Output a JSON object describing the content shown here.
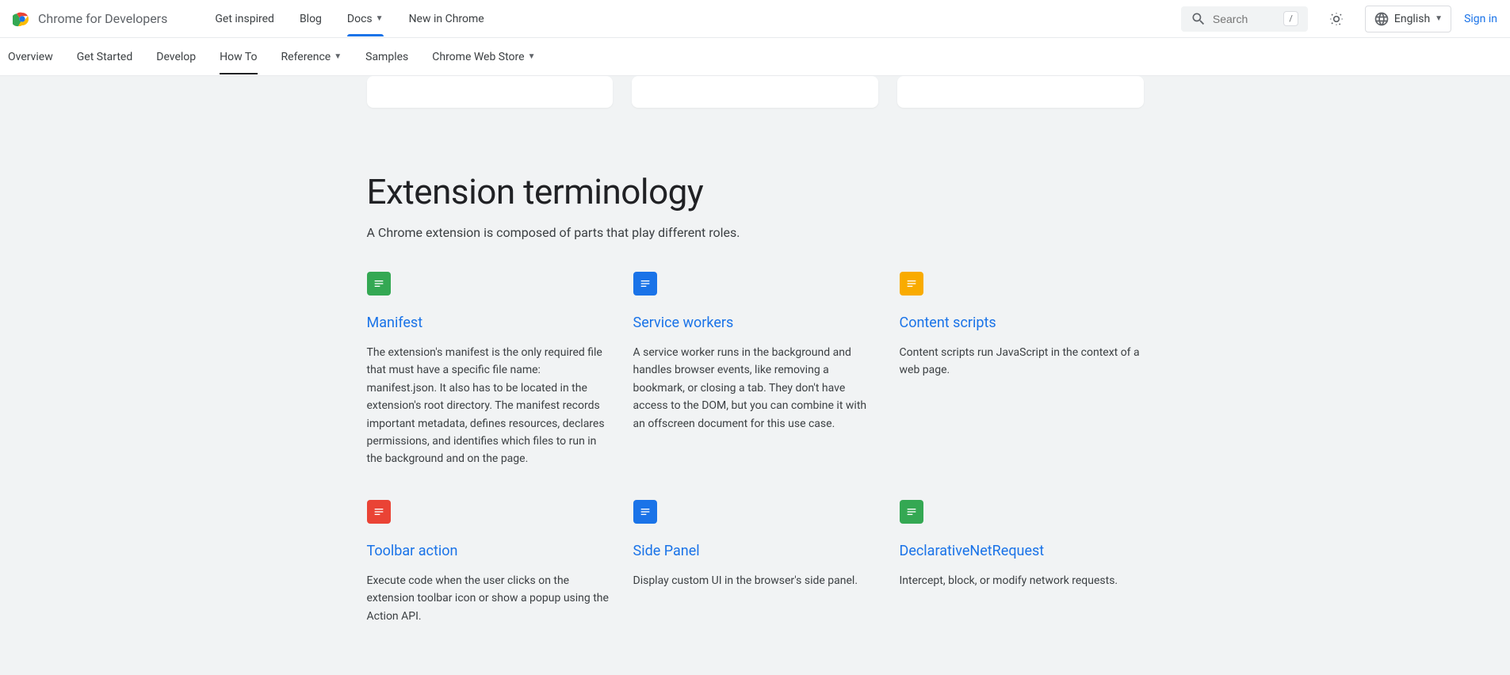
{
  "header": {
    "site_title": "Chrome for Developers",
    "nav": [
      {
        "label": "Get inspired",
        "dropdown": false,
        "active": false
      },
      {
        "label": "Blog",
        "dropdown": false,
        "active": false
      },
      {
        "label": "Docs",
        "dropdown": true,
        "active": true
      },
      {
        "label": "New in Chrome",
        "dropdown": false,
        "active": false
      }
    ],
    "search_placeholder": "Search",
    "search_shortcut": "/",
    "language": "English",
    "signin": "Sign in"
  },
  "subnav": [
    {
      "label": "Overview",
      "dropdown": false,
      "active": false
    },
    {
      "label": "Get Started",
      "dropdown": false,
      "active": false
    },
    {
      "label": "Develop",
      "dropdown": false,
      "active": false
    },
    {
      "label": "How To",
      "dropdown": false,
      "active": true
    },
    {
      "label": "Reference",
      "dropdown": true,
      "active": false
    },
    {
      "label": "Samples",
      "dropdown": false,
      "active": false
    },
    {
      "label": "Chrome Web Store",
      "dropdown": true,
      "active": false
    }
  ],
  "section": {
    "title": "Extension terminology",
    "subtitle": "A Chrome extension is composed of parts that play different roles."
  },
  "terms": [
    {
      "icon_color": "green",
      "title": "Manifest",
      "desc": "The extension's manifest is the only required file that must have a specific file name: manifest.json. It also has to be located in the extension's root directory. The manifest records important metadata, defines resources, declares permissions, and identifies which files to run in the background and on the page."
    },
    {
      "icon_color": "blue",
      "title": "Service workers",
      "desc": "A service worker runs in the background and handles browser events, like removing a bookmark, or closing a tab. They don't have access to the DOM, but you can combine it with an offscreen document for this use case."
    },
    {
      "icon_color": "orange",
      "title": "Content scripts",
      "desc": "Content scripts run JavaScript in the context of a web page."
    },
    {
      "icon_color": "red",
      "title": "Toolbar action",
      "desc": "Execute code when the user clicks on the extension toolbar icon or show a popup using the Action API."
    },
    {
      "icon_color": "blue",
      "title": "Side Panel",
      "desc": "Display custom UI in the browser's side panel."
    },
    {
      "icon_color": "green",
      "title": "DeclarativeNetRequest",
      "desc": "Intercept, block, or modify network requests."
    }
  ]
}
